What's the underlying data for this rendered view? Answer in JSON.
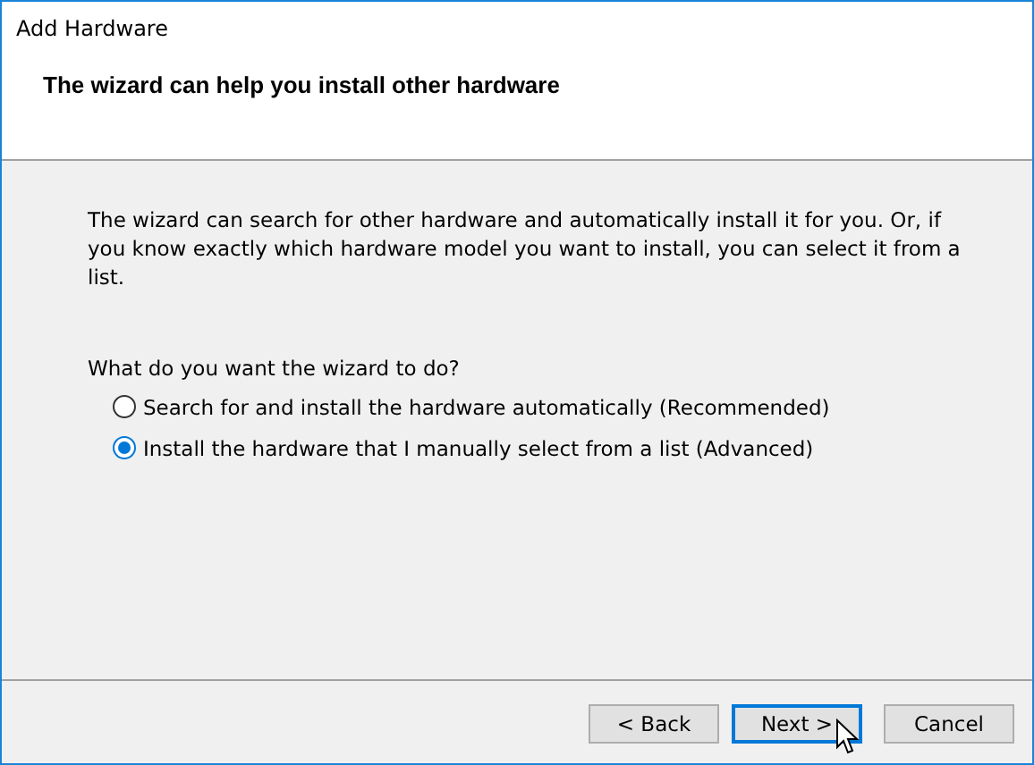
{
  "window": {
    "title": "Add Hardware"
  },
  "header": {
    "title": "The wizard can help you install other hardware"
  },
  "description": "The wizard can search for other hardware and automatically install it for you. Or, if you know exactly which hardware model you want to install, you can select it from a list.",
  "question": "What do you want the wizard to do?",
  "options": [
    {
      "label": "Search for and install the hardware automatically (Recommended)",
      "selected": false
    },
    {
      "label": "Install the hardware that I manually select from a list (Advanced)",
      "selected": true
    }
  ],
  "buttons": [
    {
      "label": "< Back",
      "focused": false
    },
    {
      "label": "Next >",
      "focused": true
    },
    {
      "label": "Cancel",
      "focused": false
    }
  ]
}
